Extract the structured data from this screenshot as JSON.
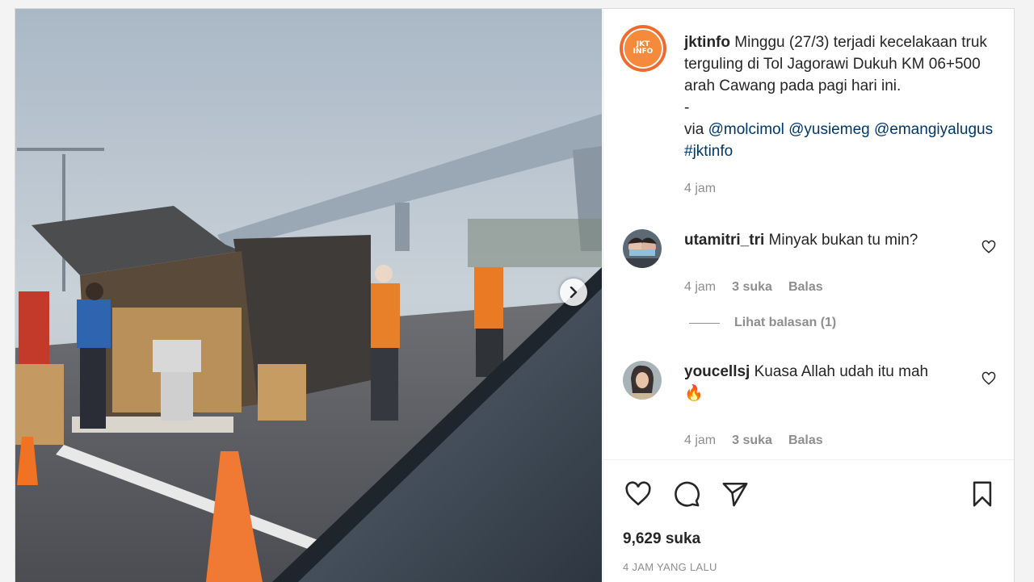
{
  "post": {
    "username": "jktinfo",
    "avatar_text_line1": "JKT",
    "avatar_text_line2": "INFO",
    "caption_text": "Minggu (27/3) terjadi kecelakaan truk terguling di Tol Jagorawi Dukuh KM 06+500 arah Cawang pada pagi hari ini.",
    "caption_dash": "-",
    "via_label": "via",
    "mentions": [
      "@molcimol",
      "@yusiemeg",
      "@emangiyalugus"
    ],
    "hashtag": "#jktinfo",
    "time": "4 jam"
  },
  "comments": [
    {
      "username": "utamitri_tri",
      "text": "Minyak bukan tu min?",
      "time": "4 jam",
      "likes": "3 suka",
      "reply_label": "Balas",
      "view_replies": "Lihat balasan (1)"
    },
    {
      "username": "youcellsj",
      "text": "Kuasa Allah udah itu mah",
      "emoji": "🔥",
      "time": "4 jam",
      "likes": "3 suka",
      "reply_label": "Balas"
    }
  ],
  "footer": {
    "likes_count": "9,629 suka",
    "posted_ago": "4 JAM YANG LALU"
  },
  "icons": {
    "next": "chevron-right-icon",
    "like": "heart-icon",
    "comment": "comment-bubble-icon",
    "share": "paper-plane-icon",
    "save": "bookmark-icon"
  },
  "colors": {
    "link": "#00376b",
    "muted": "#8e8e8e",
    "avatar_orange": "#f06a2c"
  }
}
